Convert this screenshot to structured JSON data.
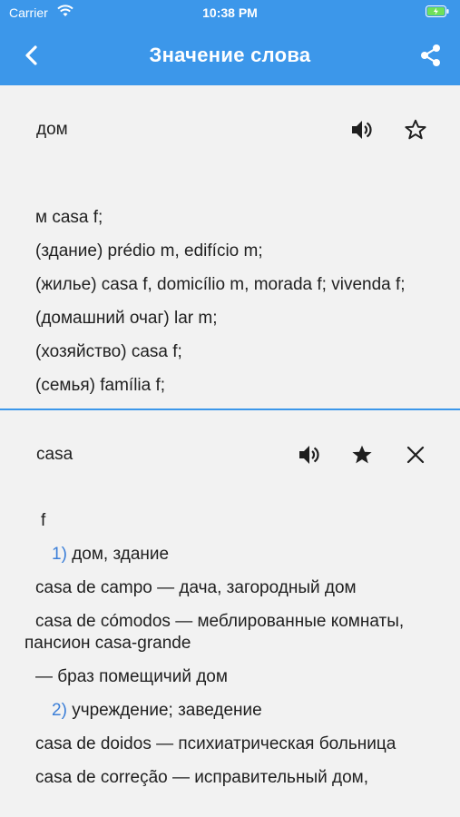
{
  "status_bar": {
    "carrier": "Carrier",
    "time": "10:38 PM"
  },
  "nav": {
    "title": "Значение слова"
  },
  "top_panel": {
    "word": "дом",
    "lines": [
      "м casa f;",
      "(здание) prédio m, edifício m;",
      "(жилье) casa f, domicílio m, morada f; vivenda f;",
      "(домашний очаг) lar m;",
      "(хозяйство) casa f;",
      "(семья) família f;"
    ]
  },
  "bottom_panel": {
    "word": "casa",
    "gender": "f",
    "sense1_num": "1)",
    "sense1_text": "дом, здание",
    "line1": "casa de campo — дача, загородный дом",
    "line2": "casa de cómodos — меблированные комнаты, пансион casa-grande",
    "line3": "— браз помещичий дом",
    "sense2_num": "2)",
    "sense2_text": "учреждение; заведение",
    "line4": "casa de doidos — психиатрическая больница",
    "line5": "casa de correção — исправительный дом,"
  },
  "colors": {
    "accent": "#3c97ea",
    "background": "#f2f2f2"
  },
  "icons": [
    "back-chevron-icon",
    "share-icon",
    "speaker-icon",
    "star-outline-icon",
    "star-filled-icon",
    "close-icon"
  ]
}
